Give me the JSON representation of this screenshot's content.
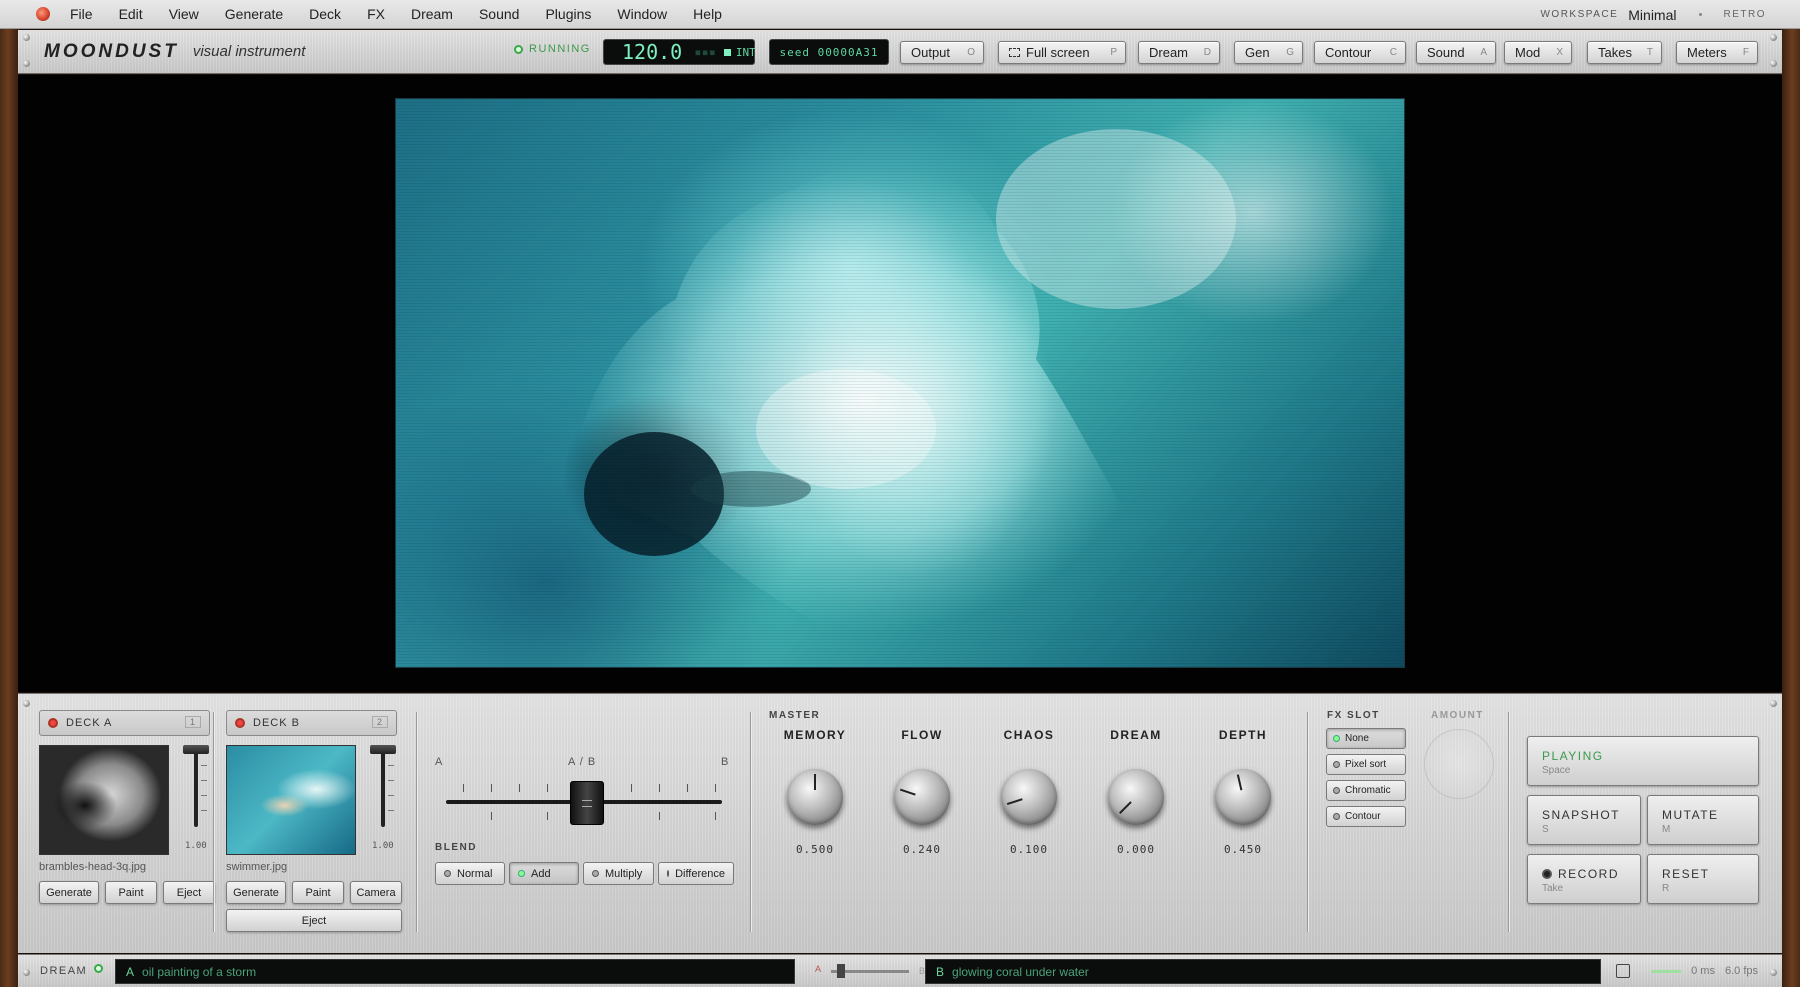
{
  "menubar": {
    "items": [
      "File",
      "Edit",
      "View",
      "Generate",
      "Deck",
      "FX",
      "Dream",
      "Sound",
      "Plugins",
      "Window",
      "Help"
    ],
    "workspace_label": "WORKSPACE",
    "workspace_value": "Minimal",
    "retro_label": "RETRO"
  },
  "toolbar": {
    "brand": "MOONDUST",
    "brand_sub": "visual instrument",
    "running": "RUNNING",
    "bpm": "120.0",
    "bpm_dots": "▪▪▪",
    "int_label": "INT",
    "seed": "seed 00000A31",
    "buttons": [
      {
        "label": "Output",
        "key": "O"
      },
      {
        "label": "Full screen",
        "key": "P"
      },
      {
        "label": "Dream",
        "key": "D"
      },
      {
        "label": "Gen",
        "key": "G"
      },
      {
        "label": "Contour",
        "key": "C"
      },
      {
        "label": "Sound",
        "key": "A"
      },
      {
        "label": "Mod",
        "key": "X"
      },
      {
        "label": "Takes",
        "key": "T"
      },
      {
        "label": "Meters",
        "key": "F"
      }
    ]
  },
  "deck_a": {
    "title": "DECK A",
    "num": "1",
    "file": "brambles-head-3q.jpg",
    "level": "1.00",
    "level_value": 1.0,
    "buttons": [
      "Generate",
      "Paint",
      "Eject"
    ]
  },
  "deck_b": {
    "title": "DECK B",
    "num": "2",
    "file": "swimmer.jpg",
    "level": "1.00",
    "level_value": 1.0,
    "buttons": [
      "Generate",
      "Paint",
      "Camera"
    ],
    "eject": "Eject"
  },
  "crossfader": {
    "a": "A",
    "ab": "A / B",
    "b": "B",
    "position": 0.5
  },
  "blend": {
    "title": "BLEND",
    "modes": [
      "Normal",
      "Add",
      "Multiply",
      "Difference"
    ],
    "active": "Add"
  },
  "master": {
    "title": "MASTER",
    "knobs": [
      {
        "label": "MEMORY",
        "value": "0.500",
        "v": 0.5
      },
      {
        "label": "FLOW",
        "value": "0.240",
        "v": 0.24
      },
      {
        "label": "CHAOS",
        "value": "0.100",
        "v": 0.1
      },
      {
        "label": "DREAM",
        "value": "0.000",
        "v": 0.0
      },
      {
        "label": "DEPTH",
        "value": "0.450",
        "v": 0.45
      }
    ]
  },
  "fx": {
    "title": "FX SLOT",
    "options": [
      "None",
      "Pixel sort",
      "Chromatic",
      "Contour"
    ],
    "active": "None",
    "amount_label": "AMOUNT"
  },
  "transport": {
    "playing": "PLAYING",
    "playing_key": "Space",
    "snapshot": "SNAPSHOT",
    "snapshot_key": "S",
    "mutate": "MUTATE",
    "mutate_key": "M",
    "record": "RECORD",
    "record_key": "Take",
    "reset": "RESET",
    "reset_key": "R"
  },
  "dream": {
    "label": "DREAM",
    "prompt_a_tag": "A",
    "prompt_a": "oil painting of a storm",
    "prompt_b_tag": "B",
    "prompt_b": "glowing coral under water",
    "fader_a": "A",
    "fader_b": "B",
    "latency": "0 ms",
    "fps": "6.0 fps"
  },
  "colors": {
    "accent_green": "#3a9a4a",
    "lcd_green": "#7ff0c0",
    "record_red": "#e44444"
  }
}
